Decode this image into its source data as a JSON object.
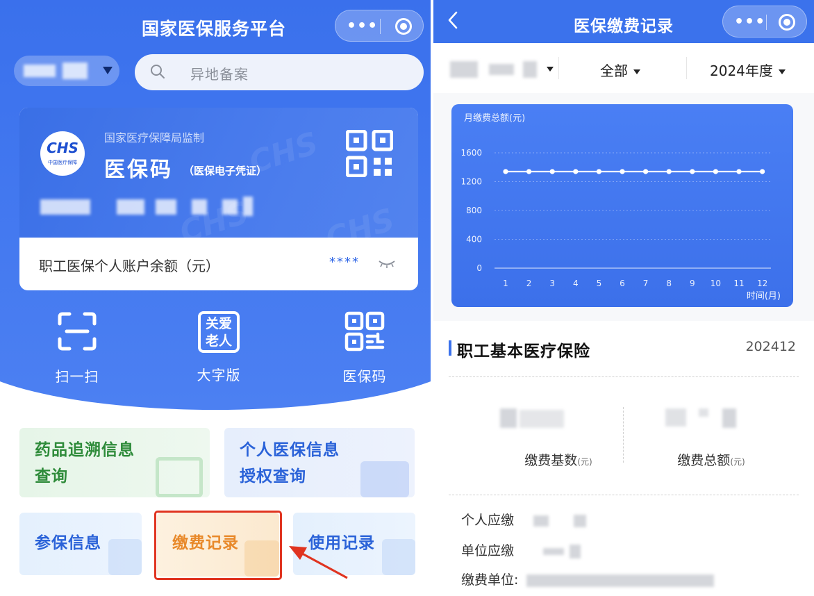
{
  "left": {
    "nav_title": "国家医保服务平台",
    "capsule_more": "•••",
    "search_placeholder": "异地备案",
    "card": {
      "supervisor": "国家医疗保障局监制",
      "title": "医保码",
      "subtitle": "（医保电子凭证）",
      "logo_text": "CHS",
      "logo_sub": "中国医疗保障",
      "watermark": "CHS",
      "balance_label": "职工医保个人账户余额（元）",
      "balance_mask": "****"
    },
    "quick_actions": [
      {
        "label": "扫一扫",
        "icon": "scan-icon"
      },
      {
        "label": "大字版",
        "icon": "elderly-care-icon",
        "icon_text_1": "关爱",
        "icon_text_2": "老人"
      },
      {
        "label": "医保码",
        "icon": "qr-code-icon"
      }
    ],
    "tiles": {
      "drug_trace": {
        "line1": "药品追溯信息",
        "line2": "查询",
        "color": "#2e8b3a"
      },
      "personal_auth": {
        "line1": "个人医保信息",
        "line2": "授权查询",
        "color": "#2a62d8"
      },
      "insured_info": {
        "label": "参保信息",
        "color": "#2a62d8"
      },
      "payment_record": {
        "label": "缴费记录",
        "color": "#e8892a"
      },
      "usage_record": {
        "label": "使用记录",
        "color": "#2a62d8"
      }
    },
    "colors": {
      "brand_blue": "#2f66e6",
      "highlight_red": "#e03420"
    }
  },
  "right": {
    "nav_title": "医保缴费记录",
    "capsule_more": "•••",
    "filters": {
      "type": "全部",
      "year": "2024年度"
    },
    "detail": {
      "title": "职工基本医疗保险",
      "period": "202412",
      "base_label": "缴费基数",
      "total_label": "缴费总额",
      "unit": "(元)",
      "personal_label": "个人应缴",
      "unit_label": "单位应缴",
      "payer_label": "缴费单位:"
    }
  },
  "chart_data": {
    "type": "line",
    "title": "月缴费总额(元)",
    "xlabel": "时间(月)",
    "ylabel": "",
    "x": [
      1,
      2,
      3,
      4,
      5,
      6,
      7,
      8,
      9,
      10,
      11,
      12
    ],
    "values": [
      1340,
      1340,
      1340,
      1340,
      1340,
      1340,
      1340,
      1340,
      1340,
      1340,
      1340,
      1340
    ],
    "ylim": [
      0,
      1600
    ],
    "yticks": [
      0,
      400,
      800,
      1200,
      1600
    ],
    "grid": true
  }
}
